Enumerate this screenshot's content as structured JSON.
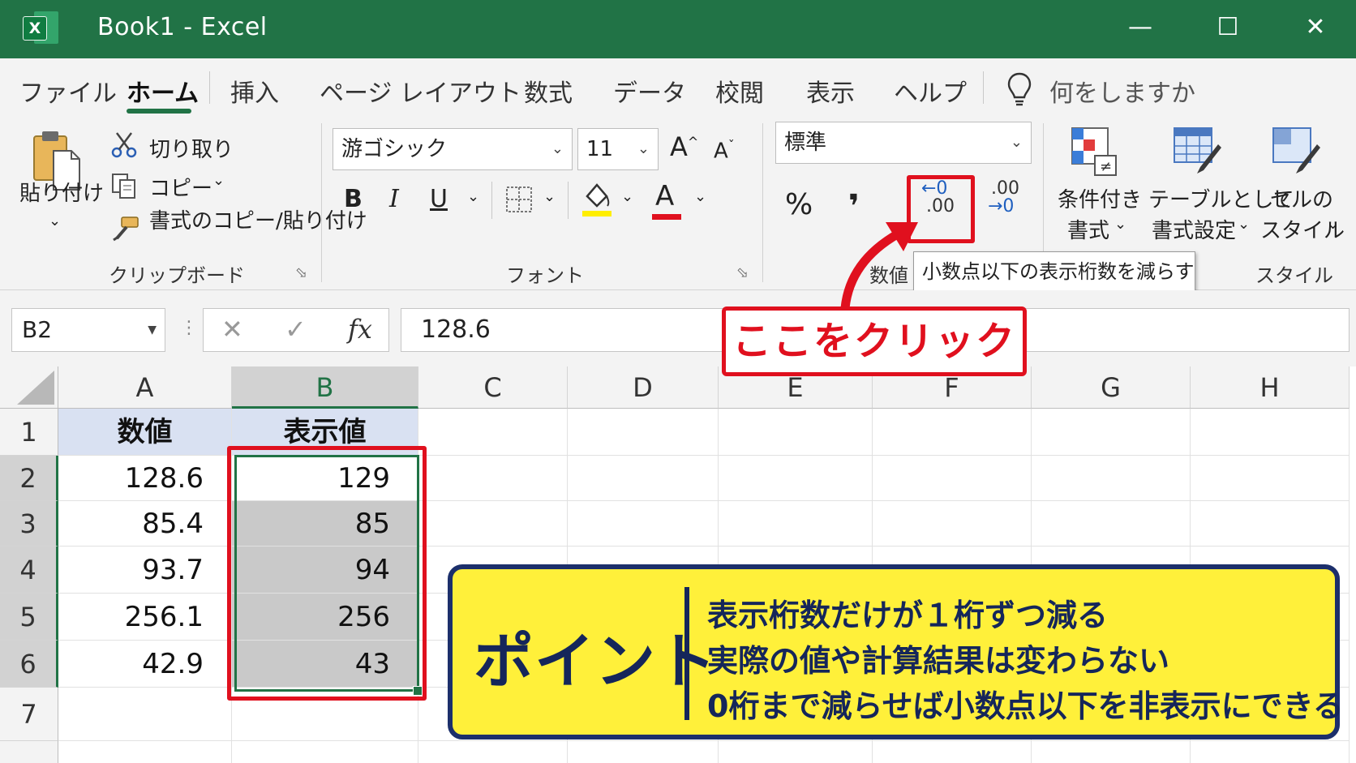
{
  "window": {
    "title": "Book1  -  Excel",
    "logo_letter": "X",
    "minimize": "—",
    "maximize": "☐",
    "close": "✕"
  },
  "ribbon": {
    "tabs": [
      "ファイル",
      "ホーム",
      "挿入",
      "ページ レイアウト",
      "数式",
      "データ",
      "校閲",
      "表示",
      "ヘルプ"
    ],
    "tell_me": "何をしますか",
    "clipboard": {
      "paste": "貼り付け",
      "cut": "切り取り",
      "copy": "コピー",
      "format_painter": "書式のコピー/貼り付け",
      "group": "クリップボード"
    },
    "font": {
      "name": "游ゴシック",
      "size": "11",
      "grow": "A",
      "shrink": "A",
      "bold": "B",
      "italic": "I",
      "underline": "U",
      "font_color_letter": "A",
      "group": "フォント",
      "fill_color": "#ffee00",
      "text_color": "#e0101e"
    },
    "number": {
      "format": "標準",
      "percent": "%",
      "comma": "❜",
      "decrease_top": "←0",
      "decrease_bottom": ".00",
      "increase_top": ".00",
      "increase_bottom": "→0",
      "group": "数値"
    },
    "styles": {
      "conditional_1": "条件付き",
      "conditional_2": "書式",
      "table_1": "テーブルとして",
      "table_2": "書式設定",
      "cell_1": "セルの",
      "cell_2": "スタイル",
      "group": "スタイル"
    },
    "tooltip": "小数点以下の表示桁数を減らす"
  },
  "formula_bar": {
    "name_box": "B2",
    "cancel": "✕",
    "enter": "✓",
    "fx": "fx",
    "value": "128.6"
  },
  "sheet": {
    "columns": [
      "A",
      "B",
      "C",
      "D",
      "E",
      "F",
      "G",
      "H"
    ],
    "rows": [
      "1",
      "2",
      "3",
      "4",
      "5",
      "6",
      "7"
    ],
    "header_row": [
      "数値",
      "表示値"
    ],
    "data": [
      [
        "128.6",
        "129"
      ],
      [
        "85.4",
        "85"
      ],
      [
        "93.7",
        "94"
      ],
      [
        "256.1",
        "256"
      ],
      [
        "42.9",
        "43"
      ]
    ]
  },
  "annotations": {
    "click_here": "ここをクリック",
    "point_title": "ポイント",
    "point_lines": [
      "表示桁数だけが１桁ずつ減る",
      "実際の値や計算結果は変わらない",
      "0桁まで減らせば小数点以下を非表示にできる"
    ],
    "accent_red": "#e0101e",
    "point_bg": "#fff03a",
    "point_fg": "#15265a"
  }
}
